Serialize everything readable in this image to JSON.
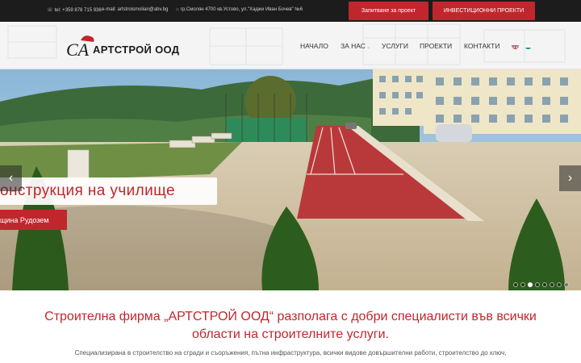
{
  "topbar": {
    "phone": "tel: +359 878 715 936",
    "email": "e-mail: artstroismolian@abv.bg",
    "address": "гр.Смолян 4700 кв.Устово, ул.\"Хаджи Иван Бочев\" №6",
    "request_button": "Запитване за проект",
    "invest_button": "ИНВЕСТИЦИОННИ ПРОЕКТИ"
  },
  "header": {
    "logo_text": "АРТСТРОЙ ООД",
    "logo_monogram": "CA",
    "nav": [
      {
        "label": "НАЧАЛО"
      },
      {
        "label": "ЗА НАС"
      },
      {
        "label": "УСЛУГИ"
      },
      {
        "label": "ПРОЕКТИ"
      },
      {
        "label": "КОНТАКТИ"
      }
    ],
    "languages": [
      "en",
      "bg"
    ]
  },
  "slider": {
    "caption_title": "онструкция на училище",
    "caption_subtitle": "щина Рудозем",
    "prev_icon": "‹",
    "next_icon": "›",
    "slide_count": 8,
    "active_slide": 2
  },
  "main": {
    "headline": "Строителна фирма „АРТСТРОЙ ООД“ разполага с добри специалисти във всички области на строителните услуги.",
    "intro": "Специализирана в строителство на сгради и съоръжения, пътна инфраструктура, всички видове довършителни работи, строителство до ключ,"
  },
  "colors": {
    "brand_red": "#c0272d",
    "topbar_bg": "#1c1c1c"
  }
}
